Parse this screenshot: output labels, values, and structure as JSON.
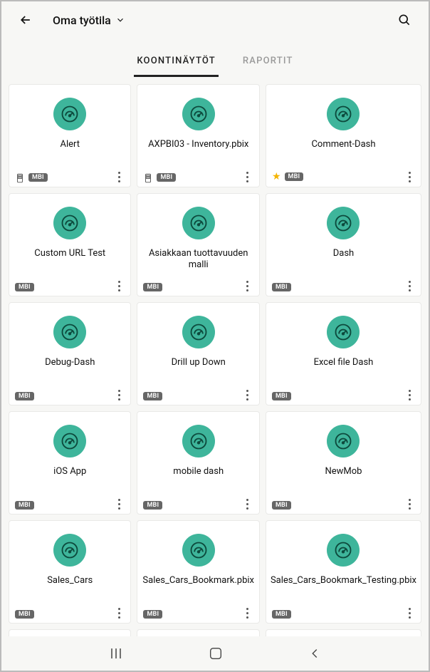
{
  "header": {
    "workspace_label": "Oma työtila"
  },
  "tabs": {
    "dashboards": "KOONTINÄYTÖT",
    "reports": "RAPORTIT"
  },
  "badge": "MBI",
  "cards": [
    {
      "title": "Alert",
      "badge": true,
      "phone_layout": true,
      "star": false
    },
    {
      "title": "AXPBI03 - Inventory.pbix",
      "badge": true,
      "phone_layout": true,
      "star": false
    },
    {
      "title": "Comment-Dash",
      "badge": true,
      "phone_layout": false,
      "star": true
    },
    {
      "title": "Custom URL Test",
      "badge": true,
      "phone_layout": false,
      "star": false
    },
    {
      "title": "Asiakkaan tuottavuuden malli",
      "badge": true,
      "phone_layout": false,
      "star": false
    },
    {
      "title": "Dash",
      "badge": true,
      "phone_layout": false,
      "star": false
    },
    {
      "title": "Debug-Dash",
      "badge": true,
      "phone_layout": false,
      "star": false
    },
    {
      "title": "Drill up Down",
      "badge": true,
      "phone_layout": false,
      "star": false
    },
    {
      "title": "Excel file Dash",
      "badge": true,
      "phone_layout": false,
      "star": false
    },
    {
      "title": "iOS App",
      "badge": true,
      "phone_layout": false,
      "star": false
    },
    {
      "title": "mobile dash",
      "badge": true,
      "phone_layout": false,
      "star": false
    },
    {
      "title": "NewMob",
      "badge": true,
      "phone_layout": false,
      "star": false
    },
    {
      "title": "Sales_Cars",
      "badge": true,
      "phone_layout": false,
      "star": false
    },
    {
      "title": "Sales_Cars_Bookmark.pbix",
      "badge": true,
      "phone_layout": false,
      "star": false
    },
    {
      "title": "Sales_Cars_Bookmark_Testing.pbix",
      "badge": true,
      "phone_layout": false,
      "star": false
    }
  ]
}
